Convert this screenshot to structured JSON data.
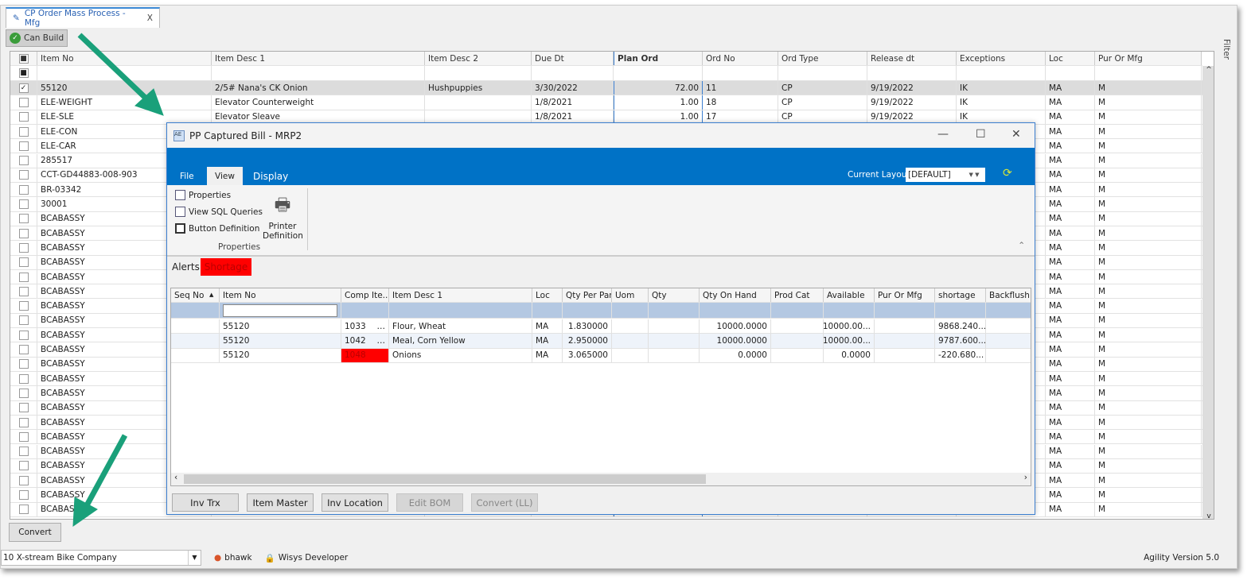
{
  "tab": {
    "title": "CP Order Mass Process - Mfg",
    "close": "X"
  },
  "toolbar": {
    "can_build": "Can Build",
    "filter": "Filter"
  },
  "grid": {
    "columns": [
      "Item No",
      "Item Desc 1",
      "Item Desc 2",
      "Due Dt",
      "Plan Ord",
      "Ord No",
      "Ord Type",
      "Release dt",
      "Exceptions",
      "Loc",
      "Pur Or Mfg"
    ],
    "rows": [
      {
        "checked": true,
        "item": "55120",
        "desc1": "2/5# Nana's CK Onion",
        "desc2": "Hushpuppies",
        "due": "3/30/2022",
        "plan": "72.00",
        "ordno": "11",
        "type": "CP",
        "release": "9/19/2022",
        "exc": "IK",
        "loc": "MA",
        "pm": "M"
      },
      {
        "item": "ELE-WEIGHT",
        "desc1": "Elevator Counterweight",
        "desc2": "",
        "due": "1/8/2021",
        "plan": "1.00",
        "ordno": "18",
        "type": "CP",
        "release": "9/19/2022",
        "exc": "IK",
        "loc": "MA",
        "pm": "M"
      },
      {
        "item": "ELE-SLE",
        "desc1": "Elevator Sleave",
        "desc2": "",
        "due": "1/8/2021",
        "plan": "1.00",
        "ordno": "17",
        "type": "CP",
        "release": "9/19/2022",
        "exc": "IK",
        "loc": "MA",
        "pm": "M"
      },
      {
        "item": "ELE-CON",
        "loc": "MA",
        "pm": "M"
      },
      {
        "item": "ELE-CAR",
        "loc": "MA",
        "pm": "M"
      },
      {
        "item": "285517",
        "loc": "MA",
        "pm": "M"
      },
      {
        "item": "CCT-GD44883-008-903",
        "loc": "MA",
        "pm": "M"
      },
      {
        "item": "BR-03342",
        "loc": "MA",
        "pm": "M"
      },
      {
        "item": "30001",
        "loc": "MA",
        "pm": "M"
      },
      {
        "item": "BCABASSY",
        "loc": "MA",
        "pm": "M"
      },
      {
        "item": "BCABASSY",
        "loc": "MA",
        "pm": "M"
      },
      {
        "item": "BCABASSY",
        "loc": "MA",
        "pm": "M"
      },
      {
        "item": "BCABASSY",
        "loc": "MA",
        "pm": "M"
      },
      {
        "item": "BCABASSY",
        "loc": "MA",
        "pm": "M"
      },
      {
        "item": "BCABASSY",
        "loc": "MA",
        "pm": "M"
      },
      {
        "item": "BCABASSY",
        "loc": "MA",
        "pm": "M"
      },
      {
        "item": "BCABASSY",
        "loc": "MA",
        "pm": "M"
      },
      {
        "item": "BCABASSY",
        "loc": "MA",
        "pm": "M"
      },
      {
        "item": "BCABASSY",
        "loc": "MA",
        "pm": "M"
      },
      {
        "item": "BCABASSY",
        "loc": "MA",
        "pm": "M"
      },
      {
        "item": "BCABASSY",
        "loc": "MA",
        "pm": "M"
      },
      {
        "item": "BCABASSY",
        "loc": "MA",
        "pm": "M"
      },
      {
        "item": "BCABASSY",
        "loc": "MA",
        "pm": "M"
      },
      {
        "item": "BCABASSY",
        "loc": "MA",
        "pm": "M"
      },
      {
        "item": "BCABASSY",
        "loc": "MA",
        "pm": "M"
      },
      {
        "item": "BCABASSY",
        "loc": "MA",
        "pm": "M"
      },
      {
        "item": "BCABASSY",
        "loc": "MA",
        "pm": "M"
      },
      {
        "item": "BCABASSY",
        "loc": "MA",
        "pm": "M"
      },
      {
        "item": "BCABASSY",
        "loc": "MA",
        "pm": "M"
      },
      {
        "item": "BCABASSY",
        "loc": "MA",
        "pm": "M"
      }
    ]
  },
  "convert": "Convert",
  "dialog": {
    "title": "PP Captured Bill - MRP2",
    "ribbon_tabs": [
      "File",
      "View",
      "Display"
    ],
    "layout_label": "Current Layout",
    "layout_value": "[DEFAULT]",
    "items": [
      "Properties",
      "View SQL Queries",
      "Button Definition"
    ],
    "printer": "Printer Definition",
    "group": "Properties",
    "alerts_label": "Alerts",
    "alert": "Shortage",
    "columns": [
      "Seq No",
      "Item No",
      "Comp Ite...",
      "Item Desc 1",
      "Loc",
      "Qty Per Par",
      "Uom",
      "Qty",
      "Qty On Hand",
      "Prod Cat",
      "Available",
      "Pur Or Mfg",
      "shortage",
      "Backflush Fg"
    ],
    "rows": [
      [
        "",
        "55120",
        "1033",
        "Flour, Wheat",
        "MA",
        "1.830000",
        "",
        "",
        "10000.0000",
        "",
        "10000.00...",
        "",
        "9868.240...",
        ""
      ],
      [
        "",
        "55120",
        "1042",
        "Meal, Corn Yellow",
        "MA",
        "2.950000",
        "",
        "",
        "10000.0000",
        "",
        "10000.00...",
        "",
        "9787.600...",
        ""
      ],
      [
        "",
        "55120",
        "1048",
        "Onions",
        "MA",
        "3.065000",
        "",
        "",
        "0.0000",
        "",
        "0.0000",
        "",
        "-220.680...",
        ""
      ]
    ],
    "buttons": [
      {
        "label": "Inv Trx",
        "enabled": true
      },
      {
        "label": "Item Master",
        "enabled": true
      },
      {
        "label": "Inv Location",
        "enabled": true
      },
      {
        "label": "Edit BOM",
        "enabled": false
      },
      {
        "label": "Convert (LL)",
        "enabled": false
      }
    ],
    "colors": {
      "ribbon": "#0072c6",
      "alert": "#ff0000"
    }
  },
  "status": {
    "company": "10 X-stream Bike Company",
    "user": "bhawk",
    "role": "Wisys Developer",
    "version": "Agility Version 5.0"
  }
}
